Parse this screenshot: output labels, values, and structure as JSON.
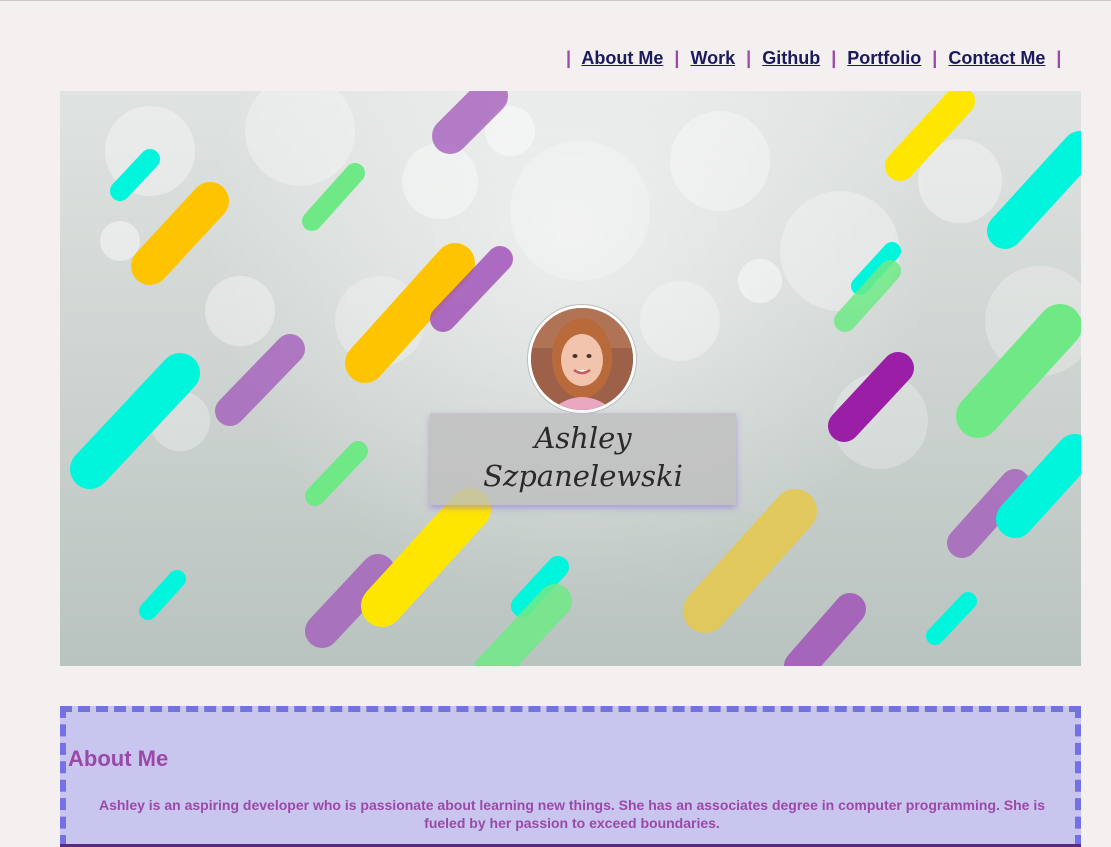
{
  "nav": {
    "separator": "|",
    "items": [
      {
        "label": "About Me"
      },
      {
        "label": "Work"
      },
      {
        "label": "Github"
      },
      {
        "label": "Portfolio"
      },
      {
        "label": "Contact Me"
      }
    ]
  },
  "hero": {
    "name_line1": "Ashley",
    "name_line2": "Szpanelewski"
  },
  "about": {
    "heading": "About Me",
    "body": "Ashley is an aspiring developer who is passionate about learning new things. She has an associates degree in computer programming. She is fueled by her passion to exceed boundaries."
  },
  "colors": {
    "accent": "#9b49a8",
    "nav_link": "#1a1a5e",
    "about_bg": "#c8c6ee",
    "about_border": "#7470e6",
    "stripe_yellow": "#ffc400",
    "stripe_cyan": "#00f5dd",
    "stripe_green": "#6ee986",
    "stripe_purple": "#a155b9"
  }
}
